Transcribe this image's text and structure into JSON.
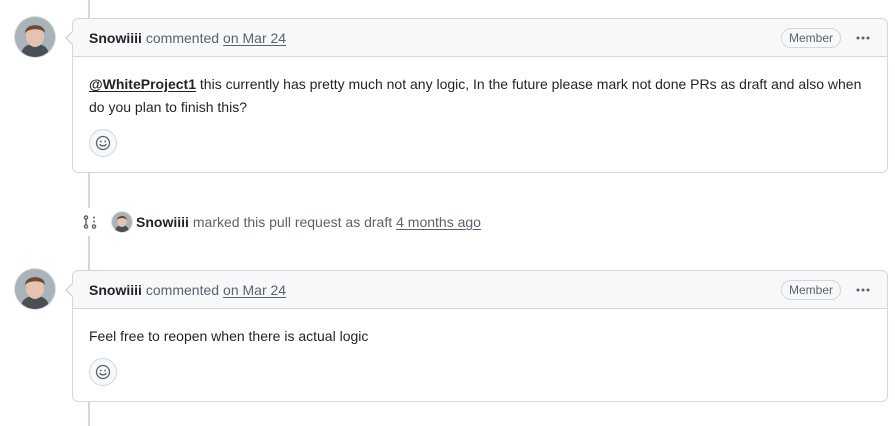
{
  "comments": [
    {
      "author": "Snowiiii",
      "action": "commented",
      "time": "on Mar 24",
      "badge": "Member",
      "mention": "@WhiteProject1",
      "body": " this currently has pretty much not any logic, In the future please mark not done PRs as draft and also when do you plan to finish this?"
    },
    {
      "author": "Snowiiii",
      "action": "commented",
      "time": "on Mar 24",
      "badge": "Member",
      "body": "Feel free to reopen when there is actual logic"
    }
  ],
  "event": {
    "icon": "git-pull-request-draft-icon",
    "author": "Snowiiii",
    "text": "marked this pull request as draft",
    "time": "4 months ago"
  },
  "colors": {
    "border": "#d0d7de",
    "header_bg": "#f6f8fa",
    "muted_text": "#59636e",
    "text": "#1f2328"
  }
}
